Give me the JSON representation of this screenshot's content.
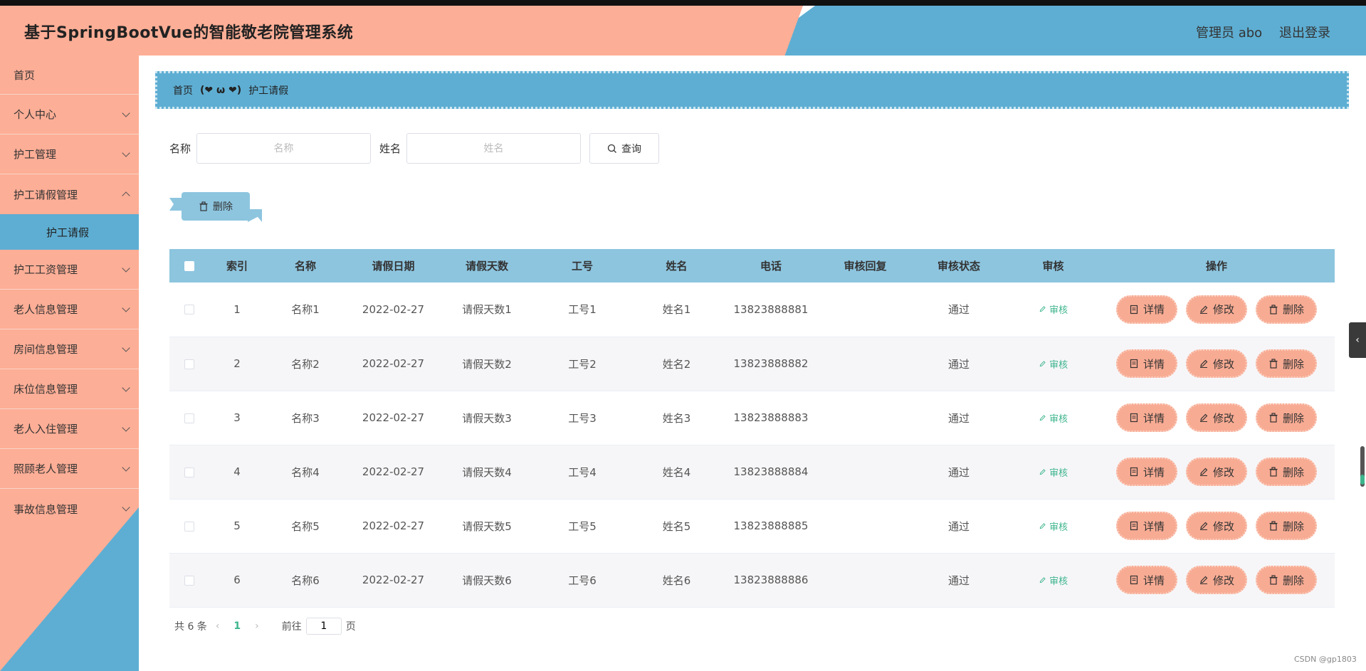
{
  "header": {
    "title": "基于SpringBootVue的智能敬老院管理系统",
    "user": "管理员 abo",
    "logout": "退出登录"
  },
  "sidebar": {
    "items": [
      {
        "label": "首页"
      },
      {
        "label": "个人中心"
      },
      {
        "label": "护工管理"
      },
      {
        "label": "护工请假管理"
      },
      {
        "label": "护工请假"
      },
      {
        "label": "护工工资管理"
      },
      {
        "label": "老人信息管理"
      },
      {
        "label": "房间信息管理"
      },
      {
        "label": "床位信息管理"
      },
      {
        "label": "老人入住管理"
      },
      {
        "label": "照顾老人管理"
      },
      {
        "label": "事故信息管理"
      }
    ]
  },
  "breadcrumb": {
    "home": "首页",
    "separator": "(❤ ω ❤)",
    "current": "护工请假"
  },
  "search": {
    "name_label": "名称",
    "name_placeholder": "名称",
    "person_label": "姓名",
    "person_placeholder": "姓名",
    "query_button": "查询"
  },
  "toolbar": {
    "delete_button": "删除"
  },
  "table": {
    "headers": [
      "索引",
      "名称",
      "请假日期",
      "请假天数",
      "工号",
      "姓名",
      "电话",
      "审核回复",
      "审核状态",
      "审核",
      "操作"
    ],
    "rows": [
      {
        "index": "1",
        "name": "名称1",
        "date": "2022-02-27",
        "days": "请假天数1",
        "no": "工号1",
        "person": "姓名1",
        "phone": "13823888881",
        "reply": "",
        "status": "通过"
      },
      {
        "index": "2",
        "name": "名称2",
        "date": "2022-02-27",
        "days": "请假天数2",
        "no": "工号2",
        "person": "姓名2",
        "phone": "13823888882",
        "reply": "",
        "status": "通过"
      },
      {
        "index": "3",
        "name": "名称3",
        "date": "2022-02-27",
        "days": "请假天数3",
        "no": "工号3",
        "person": "姓名3",
        "phone": "13823888883",
        "reply": "",
        "status": "通过"
      },
      {
        "index": "4",
        "name": "名称4",
        "date": "2022-02-27",
        "days": "请假天数4",
        "no": "工号4",
        "person": "姓名4",
        "phone": "13823888884",
        "reply": "",
        "status": "通过"
      },
      {
        "index": "5",
        "name": "名称5",
        "date": "2022-02-27",
        "days": "请假天数5",
        "no": "工号5",
        "person": "姓名5",
        "phone": "13823888885",
        "reply": "",
        "status": "通过"
      },
      {
        "index": "6",
        "name": "名称6",
        "date": "2022-02-27",
        "days": "请假天数6",
        "no": "工号6",
        "person": "姓名6",
        "phone": "13823888886",
        "reply": "",
        "status": "通过"
      }
    ],
    "audit_label": "审核",
    "op_detail": "详情",
    "op_edit": "修改",
    "op_delete": "删除"
  },
  "pagination": {
    "total": "共 6 条",
    "current": "1",
    "goto_label": "前往",
    "goto_value": "1",
    "page_suffix": "页"
  },
  "watermark": "CSDN @gp1803"
}
